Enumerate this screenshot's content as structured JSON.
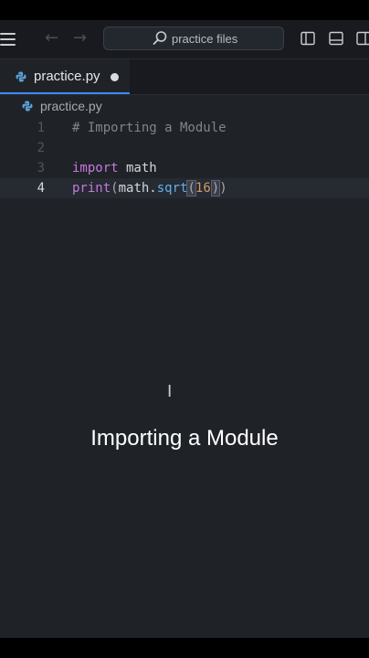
{
  "search": {
    "text": "practice files",
    "icon": "search-icon"
  },
  "nav": {
    "back_glyph": "←",
    "forward_glyph": "→"
  },
  "tab": {
    "label": "practice.py",
    "modified": true
  },
  "breadcrumb": {
    "file": "practice.py"
  },
  "editor": {
    "lines": [
      {
        "number": "1",
        "text": "# Importing a Module"
      },
      {
        "number": "2",
        "text": ""
      },
      {
        "number": "3",
        "text": "import math"
      },
      {
        "number": "4",
        "text": "print(math.sqrt(16))"
      }
    ],
    "current_line": "4"
  },
  "caption": "Importing a Module",
  "colors": {
    "background": "#1f2328",
    "keyword": "#c678dd",
    "number": "#d19a66",
    "comment": "#7f848e",
    "accent": "#3d8bfd"
  }
}
